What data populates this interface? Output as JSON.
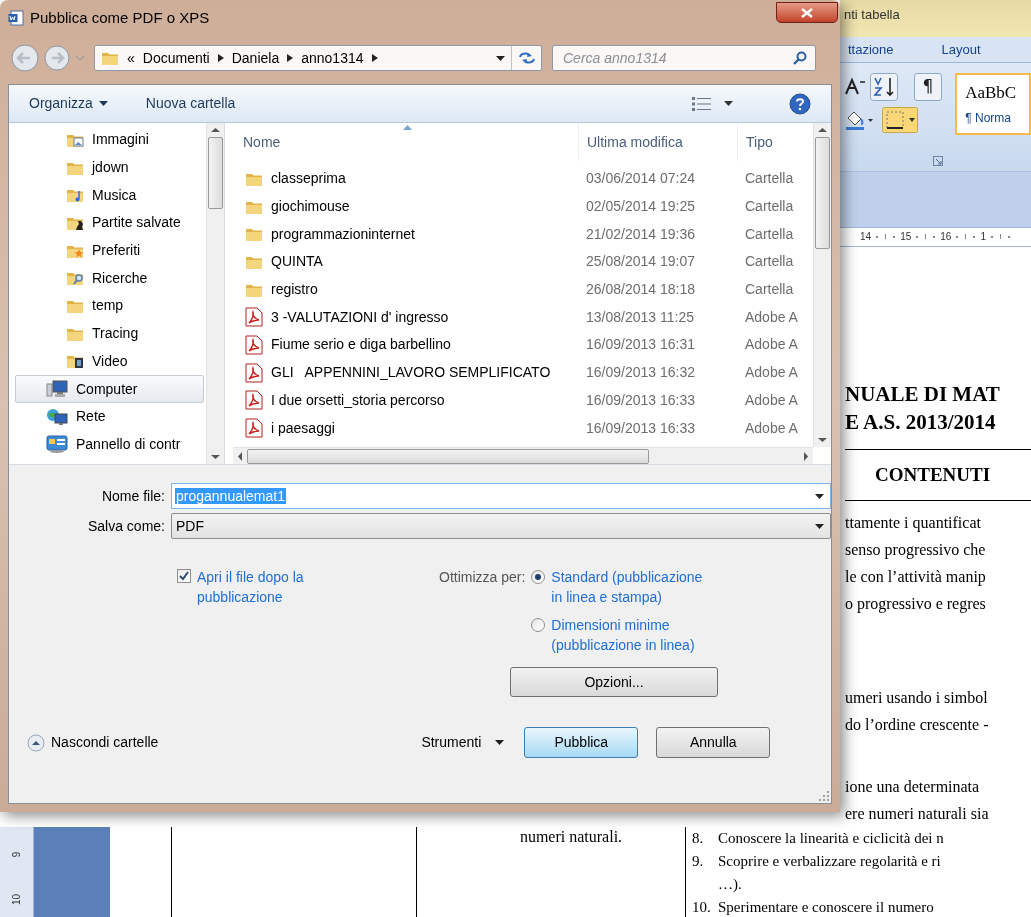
{
  "word": {
    "contextual_tab": "nti tabella",
    "ribbon_tabs": [
      "ttazione",
      "Layout"
    ],
    "pilcrow_button": "¶",
    "style_gallery": {
      "sample": "AaBbC",
      "style_name": "¶ Norma",
      "selected": true
    },
    "ruler_numbers": [
      "14",
      "15",
      "16",
      "1"
    ],
    "vertical_ruler_numbers": [
      "9",
      "10"
    ],
    "document_blocks": [
      {
        "kind": "title",
        "lines": [
          "NUALE DI MAT",
          "E  A.S. 2013/2014"
        ]
      },
      {
        "kind": "heading",
        "lines": [
          "CONTENUTI"
        ]
      },
      {
        "kind": "body",
        "lines": [
          "ttamente i quantificat",
          "senso progressivo che",
          "le con l’attività manip",
          "o progressivo e regres"
        ]
      },
      {
        "kind": "body",
        "lines": [
          "umeri usando i simbol",
          "do l’ordine crescente -"
        ]
      },
      {
        "kind": "body",
        "lines": [
          "ione una determinata",
          "ere numeri naturali sia"
        ]
      }
    ],
    "table_cell_text": "numeri naturali.",
    "list_items": [
      {
        "number": "8.",
        "lines": [
          "Conoscere la linearità e ciclicità dei n"
        ]
      },
      {
        "number": "9.",
        "lines": [
          "Scoprire e verbalizzare regolarità e ri",
          "…)."
        ]
      },
      {
        "number": "10.",
        "lines": [
          "Sperimentare e conoscere  il numero"
        ]
      }
    ]
  },
  "dialog": {
    "title": "Pubblica come PDF o XPS",
    "address": {
      "overflow_mark": "«",
      "path": [
        "Documenti",
        "Daniela",
        "anno1314"
      ]
    },
    "search": {
      "placeholder": "Cerca anno1314"
    },
    "toolbar": {
      "organize": "Organizza",
      "new_folder": "Nuova cartella"
    },
    "navigation": {
      "user_folder_children": [
        {
          "label": "Immagini",
          "kind": "pictures",
          "selected": false
        },
        {
          "label": "jdown",
          "kind": "folder",
          "selected": false
        },
        {
          "label": "Musica",
          "kind": "music",
          "selected": false
        },
        {
          "label": "Partite salvate",
          "kind": "games",
          "selected": false
        },
        {
          "label": "Preferiti",
          "kind": "favorites",
          "selected": false
        },
        {
          "label": "Ricerche",
          "kind": "searches",
          "selected": false
        },
        {
          "label": "temp",
          "kind": "folder",
          "selected": false
        },
        {
          "label": "Tracing",
          "kind": "folder",
          "selected": false
        },
        {
          "label": "Video",
          "kind": "video",
          "selected": false
        }
      ],
      "roots": [
        {
          "label": "Computer",
          "kind": "computer",
          "selected": true
        },
        {
          "label": "Rete",
          "kind": "network",
          "selected": false
        },
        {
          "label": "Pannello di contr",
          "kind": "control_panel",
          "selected": false
        }
      ]
    },
    "columns": [
      {
        "label": "Nome",
        "sorted": true
      },
      {
        "label": "Ultima modifica",
        "sorted": false
      },
      {
        "label": "Tipo",
        "sorted": false
      }
    ],
    "files": [
      {
        "name": "classeprima",
        "modified": "03/06/2014 07:24",
        "type": "Cartella",
        "kind": "folder"
      },
      {
        "name": "giochimouse",
        "modified": "02/05/2014 19:25",
        "type": "Cartella",
        "kind": "folder"
      },
      {
        "name": "programmazioninternet",
        "modified": "21/02/2014 19:36",
        "type": "Cartella",
        "kind": "folder"
      },
      {
        "name": "QUINTA",
        "modified": "25/08/2014 19:07",
        "type": "Cartella",
        "kind": "folder"
      },
      {
        "name": "registro",
        "modified": "26/08/2014 18:18",
        "type": "Cartella",
        "kind": "folder"
      },
      {
        "name": "3 -VALUTAZIONI d' ingresso",
        "modified": "13/08/2013 11:25",
        "type": "Adobe A",
        "kind": "pdf"
      },
      {
        "name": "Fiume serio e diga barbellino",
        "modified": "16/09/2013 16:31",
        "type": "Adobe A",
        "kind": "pdf"
      },
      {
        "name": "GLI   APPENNINI_LAVORO SEMPLIFICATO",
        "modified": "16/09/2013 16:32",
        "type": "Adobe A",
        "kind": "pdf"
      },
      {
        "name": "I due orsetti_storia percorso",
        "modified": "16/09/2013 16:33",
        "type": "Adobe A",
        "kind": "pdf"
      },
      {
        "name": "i paesaggi",
        "modified": "16/09/2013 16:33",
        "type": "Adobe A",
        "kind": "pdf"
      }
    ],
    "file_name": {
      "label": "Nome file:",
      "value": "progannualemat1",
      "highlighted": true
    },
    "save_as": {
      "label": "Salva come:",
      "value": "PDF"
    },
    "open_after": {
      "label": "Apri il file dopo la pubblicazione",
      "checked": true
    },
    "optimize": {
      "label": "Ottimizza per:",
      "options": [
        {
          "label": "Standard (pubblicazione in linea e stampa)",
          "selected": true
        },
        {
          "label": "Dimensioni minime (pubblicazione in linea)",
          "selected": false
        }
      ]
    },
    "options_button": "Opzioni...",
    "hide_folders": "Nascondi cartelle",
    "tools": "Strumenti",
    "buttons": [
      {
        "label": "Pubblica",
        "default": true
      },
      {
        "label": "Annulla",
        "default": false
      }
    ]
  }
}
